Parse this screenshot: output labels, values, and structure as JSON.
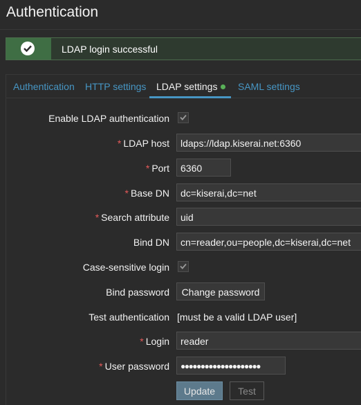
{
  "header": {
    "title": "Authentication"
  },
  "message": {
    "text": "LDAP login successful",
    "icon": "check-circle-icon",
    "status_color": "#59b158"
  },
  "tabs": [
    {
      "label": "Authentication",
      "active": false
    },
    {
      "label": "HTTP settings",
      "active": false
    },
    {
      "label": "LDAP settings",
      "active": true,
      "indicator": "green-dot"
    },
    {
      "label": "SAML settings",
      "active": false
    }
  ],
  "form": {
    "enable_ldap": {
      "label": "Enable LDAP authentication",
      "checked": true
    },
    "ldap_host": {
      "label": "LDAP host",
      "required": "*",
      "value": "ldaps://ldap.kiserai.net:6360"
    },
    "port": {
      "label": "Port",
      "required": "*",
      "value": "6360"
    },
    "base_dn": {
      "label": "Base DN",
      "required": "*",
      "value": "dc=kiserai,dc=net"
    },
    "search_attribute": {
      "label": "Search attribute",
      "required": "*",
      "value": "uid"
    },
    "bind_dn": {
      "label": "Bind DN",
      "value": "cn=reader,ou=people,dc=kiserai,dc=net"
    },
    "case_sensitive": {
      "label": "Case-sensitive login",
      "checked": true
    },
    "bind_password": {
      "label": "Bind password",
      "button": "Change password"
    },
    "test_auth": {
      "label": "Test authentication",
      "value": "[must be a valid LDAP user]"
    },
    "login": {
      "label": "Login",
      "required": "*",
      "value": "reader"
    },
    "user_password": {
      "label": "User password",
      "required": "*",
      "value": "●●●●●●●●●●●●●●●●●●●●"
    }
  },
  "buttons": {
    "update": "Update",
    "test": "Test"
  },
  "colors": {
    "accent": "#4796c4",
    "required": "#e45959",
    "success": "#59b158"
  }
}
